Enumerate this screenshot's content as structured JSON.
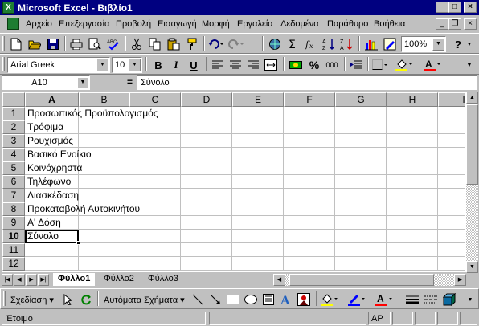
{
  "window": {
    "title": "Microsoft Excel - Βιβλίο1",
    "minimize": "_",
    "maximize": "□",
    "close": "×"
  },
  "menu": {
    "items": [
      "Αρχείο",
      "Επεξεργασία",
      "Προβολή",
      "Εισαγωγή",
      "Μορφή",
      "Εργαλεία",
      "Δεδομένα",
      "Παράθυρο",
      "Βοήθεια"
    ],
    "doc_min": "_",
    "doc_restore": "❐",
    "doc_close": "×"
  },
  "standard_toolbar": {
    "zoom": "100%",
    "help": "?"
  },
  "format_toolbar": {
    "font_name": "Arial Greek",
    "font_size": "10",
    "bold": "B",
    "italic": "I",
    "underline": "U",
    "percent": "%",
    "thousands": "000"
  },
  "formula_bar": {
    "name_box": "A10",
    "equals": "=",
    "content": "Σύνολο"
  },
  "grid": {
    "columns": [
      "A",
      "B",
      "C",
      "D",
      "E",
      "F",
      "G",
      "H",
      "I"
    ],
    "rows": [
      "1",
      "2",
      "3",
      "4",
      "5",
      "6",
      "7",
      "8",
      "9",
      "10",
      "11",
      "12"
    ],
    "cells": [
      "Προσωπικός Προϋπολογισμός",
      "Τρόφιμα",
      "Ρουχισμός",
      "Βασικό Ενοίκιο",
      "Κοινόχρηστα",
      "Τηλέφωνο",
      "Διασκέδαση",
      "Προκαταβολή Αυτοκινήτου",
      "Α' Δόση",
      "Σύνολο"
    ],
    "active_cell": "A10"
  },
  "sheets": {
    "tabs": [
      "Φύλλο1",
      "Φύλλο2",
      "Φύλλο3"
    ],
    "active": "Φύλλο1"
  },
  "drawing_toolbar": {
    "draw": "Σχεδίαση",
    "autoshapes": "Αυτόματα Σχήματα"
  },
  "status": {
    "ready": "Έτοιμο",
    "caps": "AP"
  }
}
